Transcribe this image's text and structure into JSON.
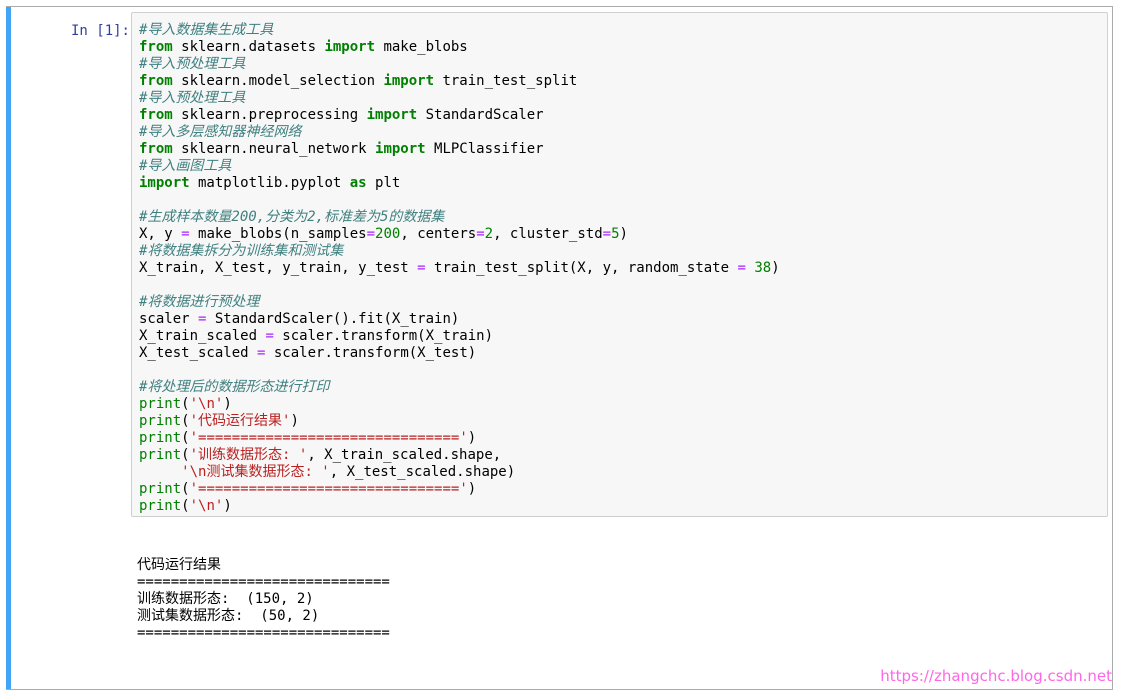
{
  "cell": {
    "prompt": "In [1]:",
    "accent_color": "#42a5f5",
    "code_lines": [
      [
        {
          "t": "#导入数据集生成工具",
          "c": "cm"
        }
      ],
      [
        {
          "t": "from",
          "c": "kw"
        },
        {
          "t": " sklearn.datasets ",
          "c": "name"
        },
        {
          "t": "import",
          "c": "kw"
        },
        {
          "t": " make_blobs",
          "c": "name"
        }
      ],
      [
        {
          "t": "#导入预处理工具",
          "c": "cm"
        }
      ],
      [
        {
          "t": "from",
          "c": "kw"
        },
        {
          "t": " sklearn.model_selection ",
          "c": "name"
        },
        {
          "t": "import",
          "c": "kw"
        },
        {
          "t": " train_test_split",
          "c": "name"
        }
      ],
      [
        {
          "t": "#导入预处理工具",
          "c": "cm"
        }
      ],
      [
        {
          "t": "from",
          "c": "kw"
        },
        {
          "t": " sklearn.preprocessing ",
          "c": "name"
        },
        {
          "t": "import",
          "c": "kw"
        },
        {
          "t": " StandardScaler",
          "c": "name"
        }
      ],
      [
        {
          "t": "#导入多层感知器神经网络",
          "c": "cm"
        }
      ],
      [
        {
          "t": "from",
          "c": "kw"
        },
        {
          "t": " sklearn.neural_network ",
          "c": "name"
        },
        {
          "t": "import",
          "c": "kw"
        },
        {
          "t": " MLPClassifier",
          "c": "name"
        }
      ],
      [
        {
          "t": "#导入画图工具",
          "c": "cm"
        }
      ],
      [
        {
          "t": "import",
          "c": "kw"
        },
        {
          "t": " matplotlib.pyplot ",
          "c": "name"
        },
        {
          "t": "as",
          "c": "kw"
        },
        {
          "t": " plt",
          "c": "name"
        }
      ],
      [],
      [
        {
          "t": "#生成样本数量200,分类为2,标准差为5的数据集",
          "c": "cm"
        }
      ],
      [
        {
          "t": "X, y ",
          "c": "name"
        },
        {
          "t": "=",
          "c": "op"
        },
        {
          "t": " make_blobs(n_samples",
          "c": "name"
        },
        {
          "t": "=",
          "c": "op"
        },
        {
          "t": "200",
          "c": "num"
        },
        {
          "t": ", centers",
          "c": "name"
        },
        {
          "t": "=",
          "c": "op"
        },
        {
          "t": "2",
          "c": "num"
        },
        {
          "t": ", cluster_std",
          "c": "name"
        },
        {
          "t": "=",
          "c": "op"
        },
        {
          "t": "5",
          "c": "num"
        },
        {
          "t": ")",
          "c": "name"
        }
      ],
      [
        {
          "t": "#将数据集拆分为训练集和测试集",
          "c": "cm"
        }
      ],
      [
        {
          "t": "X_train, X_test, y_train, y_test ",
          "c": "name"
        },
        {
          "t": "=",
          "c": "op"
        },
        {
          "t": " train_test_split(X, y, random_state ",
          "c": "name"
        },
        {
          "t": "=",
          "c": "op"
        },
        {
          "t": " ",
          "c": "name"
        },
        {
          "t": "38",
          "c": "num"
        },
        {
          "t": ")",
          "c": "name"
        }
      ],
      [],
      [
        {
          "t": "#将数据进行预处理",
          "c": "cm"
        }
      ],
      [
        {
          "t": "scaler ",
          "c": "name"
        },
        {
          "t": "=",
          "c": "op"
        },
        {
          "t": " StandardScaler().fit(X_train)",
          "c": "name"
        }
      ],
      [
        {
          "t": "X_train_scaled ",
          "c": "name"
        },
        {
          "t": "=",
          "c": "op"
        },
        {
          "t": " scaler.transform(X_train)",
          "c": "name"
        }
      ],
      [
        {
          "t": "X_test_scaled ",
          "c": "name"
        },
        {
          "t": "=",
          "c": "op"
        },
        {
          "t": " scaler.transform(X_test)",
          "c": "name"
        }
      ],
      [],
      [
        {
          "t": "#将处理后的数据形态进行打印",
          "c": "cm"
        }
      ],
      [
        {
          "t": "print",
          "c": "builtin"
        },
        {
          "t": "(",
          "c": "name"
        },
        {
          "t": "'\\n'",
          "c": "str"
        },
        {
          "t": ")",
          "c": "name"
        }
      ],
      [
        {
          "t": "print",
          "c": "builtin"
        },
        {
          "t": "(",
          "c": "name"
        },
        {
          "t": "'代码运行结果'",
          "c": "str"
        },
        {
          "t": ")",
          "c": "name"
        }
      ],
      [
        {
          "t": "print",
          "c": "builtin"
        },
        {
          "t": "(",
          "c": "name"
        },
        {
          "t": "'==============================='",
          "c": "str"
        },
        {
          "t": ")",
          "c": "name"
        }
      ],
      [
        {
          "t": "print",
          "c": "builtin"
        },
        {
          "t": "(",
          "c": "name"
        },
        {
          "t": "'训练数据形态: '",
          "c": "str"
        },
        {
          "t": ", X_train_scaled.shape,",
          "c": "name"
        }
      ],
      [
        {
          "t": "     ",
          "c": "name"
        },
        {
          "t": "'\\n测试集数据形态: '",
          "c": "str"
        },
        {
          "t": ", X_test_scaled.shape)",
          "c": "name"
        }
      ],
      [
        {
          "t": "print",
          "c": "builtin"
        },
        {
          "t": "(",
          "c": "name"
        },
        {
          "t": "'==============================='",
          "c": "str"
        },
        {
          "t": ")",
          "c": "name"
        }
      ],
      [
        {
          "t": "print",
          "c": "builtin"
        },
        {
          "t": "(",
          "c": "name"
        },
        {
          "t": "'\\n'",
          "c": "str"
        },
        {
          "t": ")",
          "c": "name"
        }
      ]
    ]
  },
  "output": {
    "lines": [
      "代码运行结果",
      "==============================",
      "训练数据形态:  (150, 2)",
      "测试集数据形态:  (50, 2)",
      "=============================="
    ]
  },
  "watermark": "https://zhangchc.blog.csdn.net"
}
